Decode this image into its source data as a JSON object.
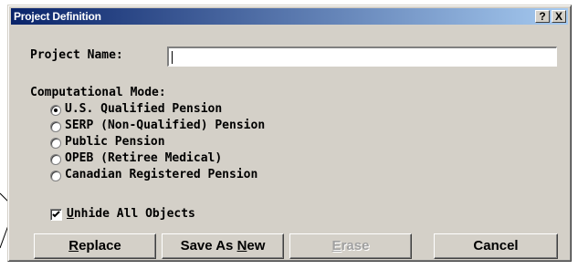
{
  "window": {
    "title": "Project Definition",
    "help_label": "?",
    "close_label": "X"
  },
  "form": {
    "project_name_label": "Project Name:",
    "project_name_value": "",
    "mode_label": "Computational Mode:",
    "modes": [
      {
        "label": "U.S. Qualified Pension",
        "selected": true
      },
      {
        "label": "SERP (Non-Qualified) Pension",
        "selected": false
      },
      {
        "label": "Public Pension",
        "selected": false
      },
      {
        "label": "OPEB (Retiree Medical)",
        "selected": false
      },
      {
        "label": "Canadian Registered Pension",
        "selected": false
      }
    ],
    "unhide_checkbox": {
      "mnemonic": "U",
      "rest": "nhide All Objects",
      "checked": true
    }
  },
  "buttons": {
    "replace": {
      "mnemonic": "R",
      "rest": "eplace",
      "enabled": true
    },
    "save_as_new": {
      "pre": "Save As ",
      "mnemonic": "N",
      "rest": "ew",
      "enabled": true
    },
    "erase": {
      "mnemonic": "E",
      "rest": "rase",
      "enabled": false
    },
    "cancel": {
      "label": "Cancel",
      "enabled": true
    }
  }
}
